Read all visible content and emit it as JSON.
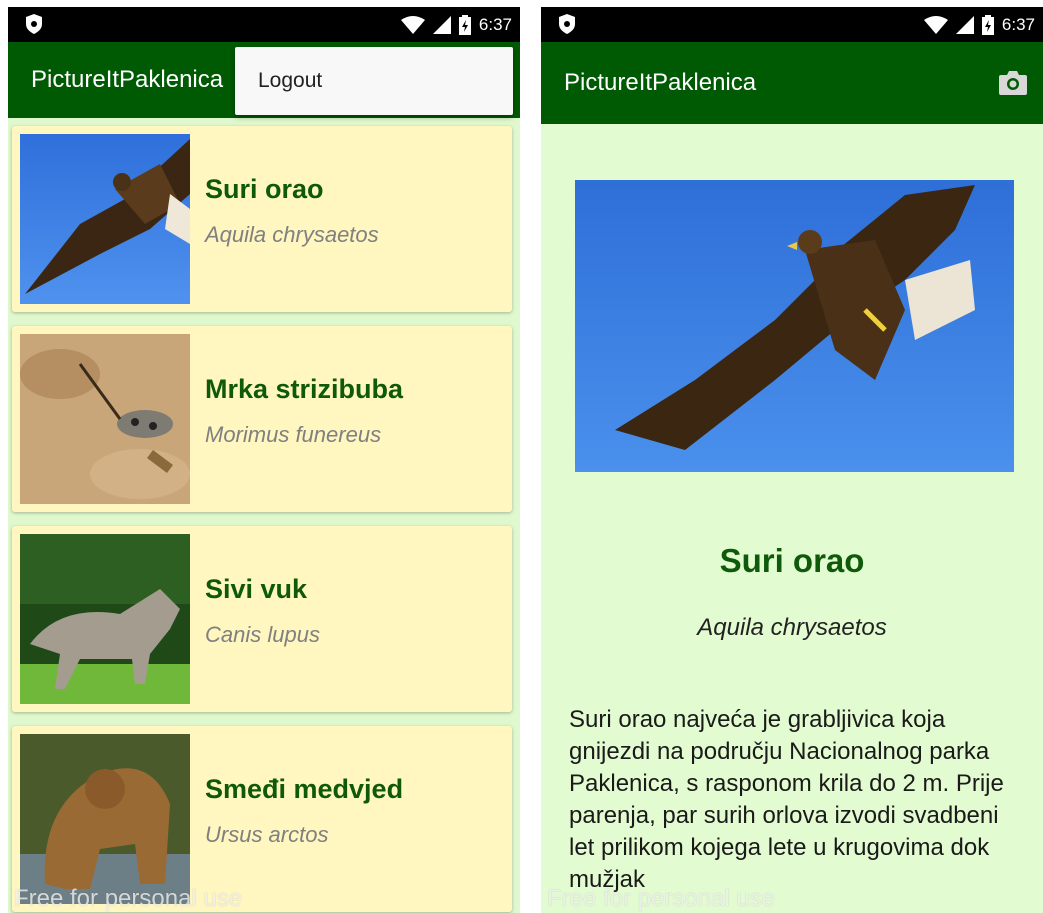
{
  "status": {
    "time": "6:37"
  },
  "app": {
    "title": "PictureItPaklenica"
  },
  "menu": {
    "logout": "Logout"
  },
  "species": [
    {
      "name": "Suri orao",
      "latin": "Aquila chrysaetos"
    },
    {
      "name": "Mrka strizibuba",
      "latin": "Morimus funereus"
    },
    {
      "name": "Sivi vuk",
      "latin": "Canis lupus"
    },
    {
      "name": "Smeđi medvjed",
      "latin": "Ursus arctos"
    }
  ],
  "detail": {
    "name": "Suri orao",
    "latin": "Aquila chrysaetos",
    "description": "Suri orao najveća je grabljivica koja gnijezdi na području Nacionalnog parka Paklenica, s rasponom krila do 2 m. Prije parenja, par surih orlova izvodi svadbeni let prilikom kojega lete u krugovima dok mužjak"
  },
  "watermark": "Free for personal use",
  "colors": {
    "appbar": "#005a03",
    "card": "#fff6c0",
    "background": "#dff8cd",
    "title_green": "#0e5a0a"
  },
  "icons": [
    "app-shield-icon",
    "wifi-icon",
    "signal-icon",
    "battery-icon",
    "camera-icon"
  ]
}
